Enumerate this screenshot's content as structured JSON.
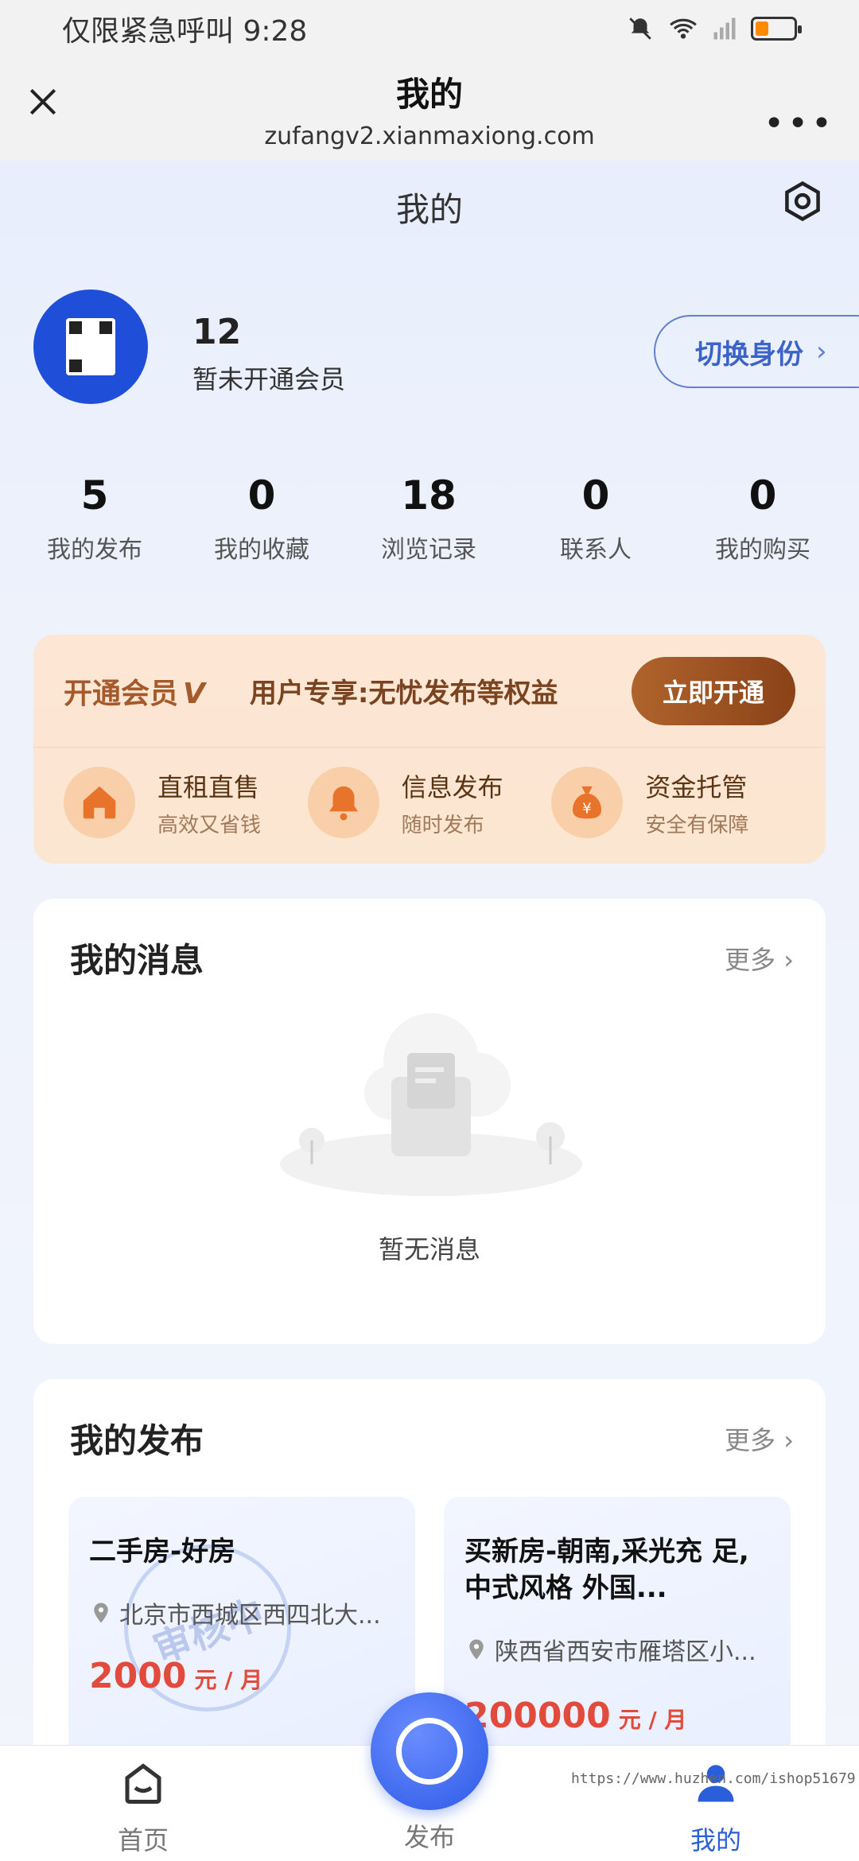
{
  "status_bar": {
    "left_text": "仅限紧急呼叫 9:28"
  },
  "web_header": {
    "title": "我的",
    "url": "zufangv2.xianmaxiong.com",
    "more": "•••"
  },
  "page": {
    "title": "我的"
  },
  "profile": {
    "name": "12",
    "status": "暂未开通会员",
    "switch_label": "切换身份",
    "switch_chevron": "›"
  },
  "stats": [
    {
      "value": "5",
      "label": "我的发布"
    },
    {
      "value": "0",
      "label": "我的收藏"
    },
    {
      "value": "18",
      "label": "浏览记录"
    },
    {
      "value": "0",
      "label": "联系人"
    },
    {
      "value": "0",
      "label": "我的购买"
    }
  ],
  "vip": {
    "title": "开通会员",
    "title_mark": "V",
    "desc": "用户专享:无忧发布等权益",
    "button": "立即开通",
    "features": [
      {
        "icon": "house-icon",
        "title": "直租直售",
        "sub": "高效又省钱"
      },
      {
        "icon": "bell-icon",
        "title": "信息发布",
        "sub": "随时发布"
      },
      {
        "icon": "money-bag-icon",
        "title": "资金托管",
        "sub": "安全有保障"
      }
    ]
  },
  "messages": {
    "title": "我的消息",
    "more": "更多 ›",
    "empty": "暂无消息"
  },
  "publications": {
    "title": "我的发布",
    "more": "更多 ›",
    "items": [
      {
        "title": "二手房-好房",
        "address": "北京市西城区西四北大...",
        "price": "2000",
        "unit": "元 / 月",
        "stamp": "审核中"
      },
      {
        "title": "买新房-朝南,采光充 足,中式风格 外国...",
        "address": "陕西省西安市雁塔区小...",
        "price": "200000",
        "unit": "元 / 月"
      }
    ]
  },
  "tabbar": {
    "home": "首页",
    "publish": "发布",
    "mine": "我的"
  },
  "watermark": "https://www.huzhen.com/ishop51679",
  "colors": {
    "accent": "#2b5fd9",
    "price": "#e24b3c",
    "vip_brown": "#8a4218"
  }
}
